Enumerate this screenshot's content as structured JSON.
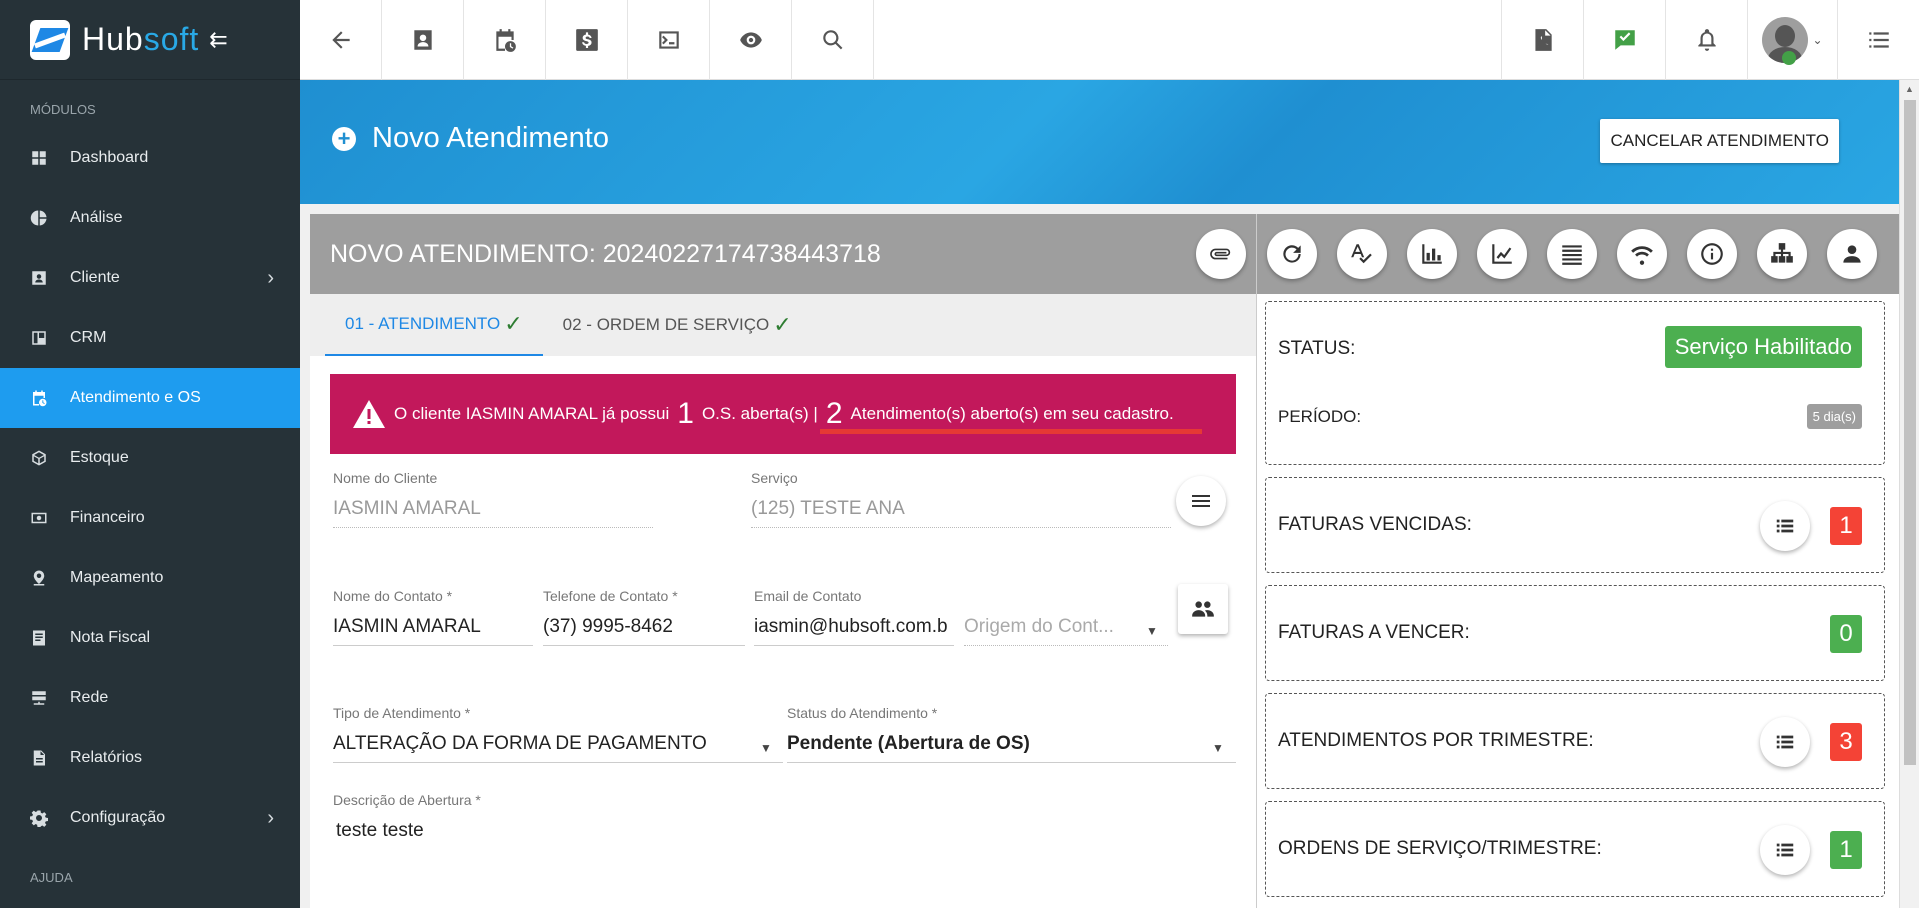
{
  "brand": {
    "part1": "Hub",
    "part2": "soft"
  },
  "sidebar": {
    "section_modules": "MÓDULOS",
    "section_help": "AJUDA",
    "items": [
      {
        "label": "Dashboard",
        "icon": "dashboard-icon"
      },
      {
        "label": "Análise",
        "icon": "pie-chart-icon"
      },
      {
        "label": "Cliente",
        "icon": "contact-card-icon",
        "has_submenu": true
      },
      {
        "label": "CRM",
        "icon": "board-icon"
      },
      {
        "label": "Atendimento e OS",
        "icon": "calendar-clock-icon",
        "active": true
      },
      {
        "label": "Estoque",
        "icon": "box-icon"
      },
      {
        "label": "Financeiro",
        "icon": "money-icon"
      },
      {
        "label": "Mapeamento",
        "icon": "map-pin-icon"
      },
      {
        "label": "Nota Fiscal",
        "icon": "receipt-icon"
      },
      {
        "label": "Rede",
        "icon": "network-icon"
      },
      {
        "label": "Relatórios",
        "icon": "document-icon"
      },
      {
        "label": "Configuração",
        "icon": "gear-icon",
        "has_submenu": true
      }
    ]
  },
  "banner": {
    "title": "Novo Atendimento",
    "cancel_label": "CANCELAR ATENDIMENTO"
  },
  "form": {
    "header": "NOVO ATENDIMENTO: 20240227174738443718",
    "tabs": [
      "01 - ATENDIMENTO",
      "02 - ORDEM DE SERVIÇO"
    ],
    "alert": {
      "prefix": "O cliente IASMIN AMARAL já possui",
      "os_count": "1",
      "os_text": "O.S. aberta(s) |",
      "att_count": "2",
      "att_text": "Atendimento(s) aberto(s) em seu cadastro."
    },
    "client_name_label": "Nome do Cliente",
    "client_name": "IASMIN AMARAL",
    "service_label": "Serviço",
    "service": "(125) TESTE ANA",
    "contact_name_label": "Nome do Contato *",
    "contact_name": "IASMIN AMARAL",
    "phone_label": "Telefone de Contato *",
    "phone": "(37) 9995-8462",
    "email_label": "Email de Contato",
    "email": "iasmin@hubsoft.com.b",
    "origin_placeholder": "Origem do Cont...",
    "type_label": "Tipo de Atendimento *",
    "type_value": "ALTERAÇÃO DA FORMA DE PAGAMENTO",
    "status_label": "Status do Atendimento *",
    "status_value": "Pendente (Abertura de OS)",
    "description_label": "Descrição de Abertura *",
    "description": "teste teste"
  },
  "summary": {
    "status_label": "STATUS:",
    "status_value": "Serviço Habilitado",
    "period_label": "PERÍODO:",
    "period_value": "5 dia(s)",
    "overdue_label": "FATURAS VENCIDAS:",
    "overdue_count": "1",
    "upcoming_label": "FATURAS A VENCER:",
    "upcoming_count": "0",
    "att_quarter_label": "ATENDIMENTOS POR TRIMESTRE:",
    "att_quarter_count": "3",
    "os_quarter_label": "ORDENS DE SERVIÇO/TRIMESTRE:",
    "os_quarter_count": "1"
  },
  "colors": {
    "sidebar_bg": "#263238",
    "active_nav": "#1e9cef",
    "banner": "#2aa6e3",
    "alert": "#c2185b",
    "badge_green": "#4caf50",
    "badge_red": "#f44336"
  }
}
